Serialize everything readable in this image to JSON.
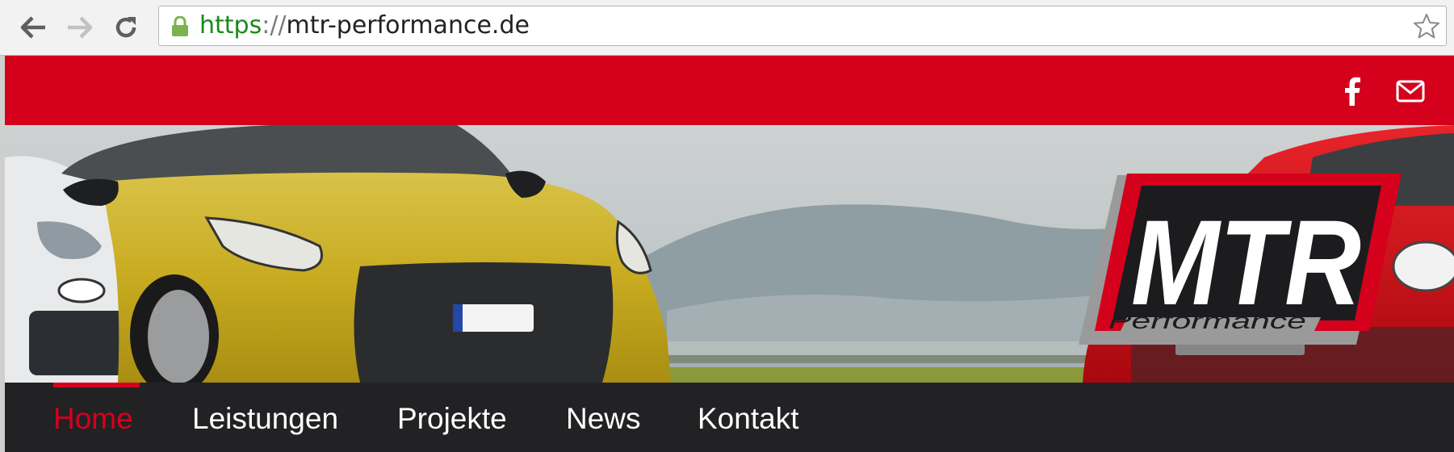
{
  "browser": {
    "url_scheme": "https",
    "url_separator": "://",
    "url_host": "mtr-performance.de"
  },
  "icons": {
    "back": "arrow-left-icon",
    "forward": "arrow-right-icon",
    "reload": "reload-icon",
    "lock": "lock-icon",
    "bookmark": "star-icon",
    "facebook": "facebook-icon",
    "email": "envelope-icon"
  },
  "logo": {
    "main": "MTR",
    "sub": "Performance"
  },
  "navigation": {
    "items": [
      {
        "label": "Home",
        "active": true
      },
      {
        "label": "Leistungen",
        "active": false
      },
      {
        "label": "Projekte",
        "active": false
      },
      {
        "label": "News",
        "active": false
      },
      {
        "label": "Kontakt",
        "active": false
      }
    ]
  },
  "colors": {
    "brand_red": "#d5001c",
    "nav_bg": "#222224",
    "url_green": "#1a8a1a"
  }
}
